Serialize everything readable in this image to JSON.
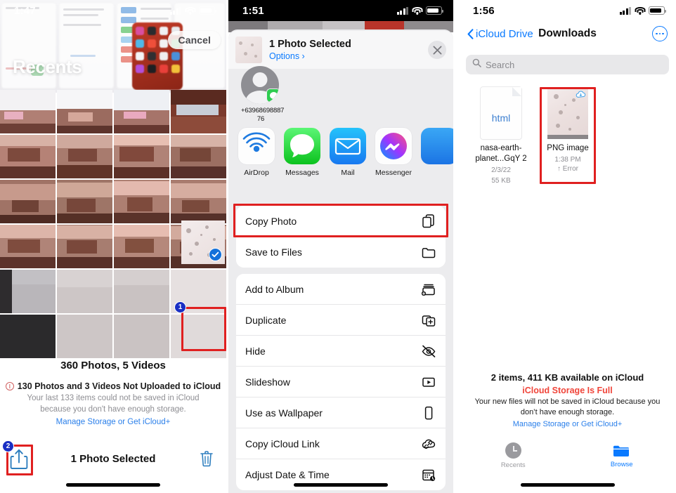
{
  "panels": {
    "left": {
      "status": {
        "clock": "1:47"
      },
      "cancel_label": "Cancel",
      "page_title": "Recents",
      "summary_count": "360 Photos, 5 Videos",
      "warning_title": "130 Photos and 3 Videos Not Uploaded to iCloud",
      "warning_body": "Your last 133 items could not be saved in iCloud because you don't have enough storage.",
      "warning_link": "Manage Storage or Get iCloud+",
      "toolbar_label": "1 Photo Selected",
      "badge_one": "1",
      "badge_two": "2",
      "icons": {
        "share": "share-icon",
        "trash": "trash-icon",
        "check": "checkmark-icon"
      }
    },
    "middle": {
      "status": {
        "clock": "1:51"
      },
      "sheet_title": "1 Photo Selected",
      "sheet_options": "Options ›",
      "close_icon": "close-icon",
      "contact_name": "+63968698887\n76",
      "apps": [
        {
          "label": "AirDrop",
          "icon": "airdrop-icon"
        },
        {
          "label": "Messages",
          "icon": "messages-icon"
        },
        {
          "label": "Mail",
          "icon": "mail-icon"
        },
        {
          "label": "Messenger",
          "icon": "messenger-icon"
        },
        {
          "label": "",
          "icon": "partial-app-icon"
        }
      ],
      "actions_group_one": [
        {
          "label": "Copy Photo",
          "icon": "copy-icon",
          "highlighted": true
        },
        {
          "label": "Save to Files",
          "icon": "folder-icon",
          "highlighted": false
        }
      ],
      "actions_group_two": [
        {
          "label": "Add to Album",
          "icon": "add-to-album-icon"
        },
        {
          "label": "Duplicate",
          "icon": "duplicate-icon"
        },
        {
          "label": "Hide",
          "icon": "hide-eye-icon"
        },
        {
          "label": "Slideshow",
          "icon": "slideshow-play-icon"
        },
        {
          "label": "Use as Wallpaper",
          "icon": "phone-icon"
        },
        {
          "label": "Copy iCloud Link",
          "icon": "icloud-link-icon"
        },
        {
          "label": "Adjust Date & Time",
          "icon": "calendar-clock-icon"
        }
      ]
    },
    "right": {
      "status": {
        "clock": "1:56"
      },
      "back_label": "iCloud Drive",
      "title": "Downloads",
      "more_icon": "more-ellipsis-icon",
      "search_placeholder": "Search",
      "files": [
        {
          "name": "nasa-earth-planet...GqY 2",
          "type_label": "html",
          "date": "2/3/22",
          "size": "55 KB",
          "kind": "document",
          "highlighted": false
        },
        {
          "name": "PNG image",
          "date": "1:38 PM",
          "status": "↑ Error",
          "kind": "image",
          "highlighted": true
        }
      ],
      "footer_count": "2 items, 411 KB available on iCloud",
      "footer_full": "iCloud Storage Is Full",
      "footer_body": "Your new files will not be saved in iCloud because you don’t have enough storage.",
      "footer_link": "Manage Storage or Get iCloud+",
      "tabs": [
        {
          "label": "Recents",
          "icon": "clock-icon",
          "active": false
        },
        {
          "label": "Browse",
          "icon": "folder-icon",
          "active": true
        }
      ]
    }
  },
  "colors": {
    "accent_blue": "#0a7aff",
    "link_blue": "#2a7fea",
    "highlight_red": "#e02020",
    "error_red": "#f0453a",
    "badge_blue": "#1a2fc4",
    "check_blue": "#1471da",
    "gray_text": "#8e8e93"
  }
}
